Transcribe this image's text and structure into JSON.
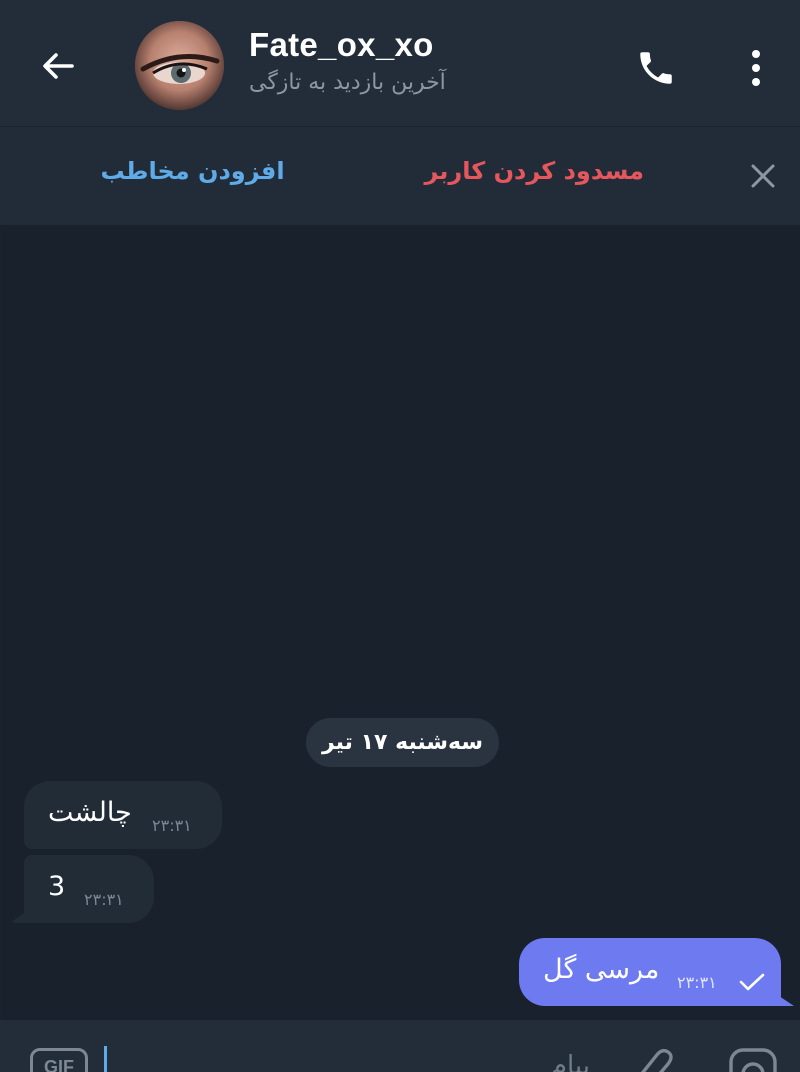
{
  "header": {
    "back_icon": "arrow-left-icon",
    "title": "Fate_ox_xo",
    "subtitle": "آخرین بازدید به تازگی",
    "call_icon": "phone-icon",
    "menu_icon": "more-vertical-icon"
  },
  "action_bar": {
    "add_contact_label": "افزودن مخاطب",
    "block_user_label": "مسدود کردن کاربر",
    "close_icon": "close-icon",
    "add_contact_color": "#5fabe8",
    "block_user_color": "#e6565d"
  },
  "chat": {
    "date_label": "سه‌شنبه ۱۷ تیر",
    "messages": [
      {
        "direction": "incoming",
        "text": "چالشت",
        "time": "۲۳:۳۱"
      },
      {
        "direction": "incoming",
        "text": "3",
        "time": "۲۳:۳۱"
      },
      {
        "direction": "outgoing",
        "text": "مرسی گل",
        "time": "۲۳:۳۱",
        "status_icon": "check-icon"
      }
    ],
    "outgoing_bubble_color": "#6e7bf0",
    "incoming_bubble_color": "#222c37"
  },
  "input": {
    "gif_label": "GIF",
    "placeholder": "پیام",
    "attach_icon": "paperclip-icon",
    "camera_icon": "camera-icon"
  }
}
